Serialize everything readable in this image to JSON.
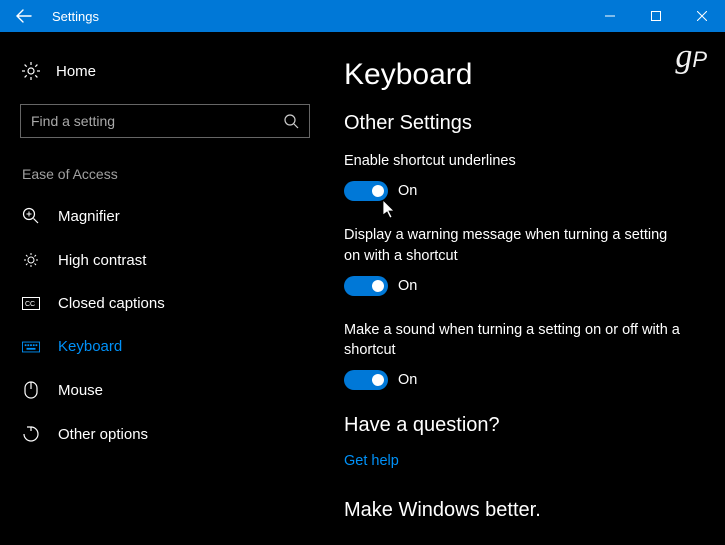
{
  "titlebar": {
    "title": "Settings"
  },
  "sidebar": {
    "home_label": "Home",
    "search_placeholder": "Find a setting",
    "category": "Ease of Access",
    "items": [
      {
        "label": "Magnifier"
      },
      {
        "label": "High contrast"
      },
      {
        "label": "Closed captions"
      },
      {
        "label": "Keyboard"
      },
      {
        "label": "Mouse"
      },
      {
        "label": "Other options"
      }
    ]
  },
  "main": {
    "title": "Keyboard",
    "section": "Other Settings",
    "settings": [
      {
        "label": "Enable shortcut underlines",
        "state": "On"
      },
      {
        "label": "Display a warning message when turning a setting on with a shortcut",
        "state": "On"
      },
      {
        "label": "Make a sound when turning a setting on or off with a shortcut",
        "state": "On"
      }
    ],
    "question_heading": "Have a question?",
    "get_help": "Get help",
    "improve_heading": "Make Windows better."
  },
  "watermark": "gP"
}
